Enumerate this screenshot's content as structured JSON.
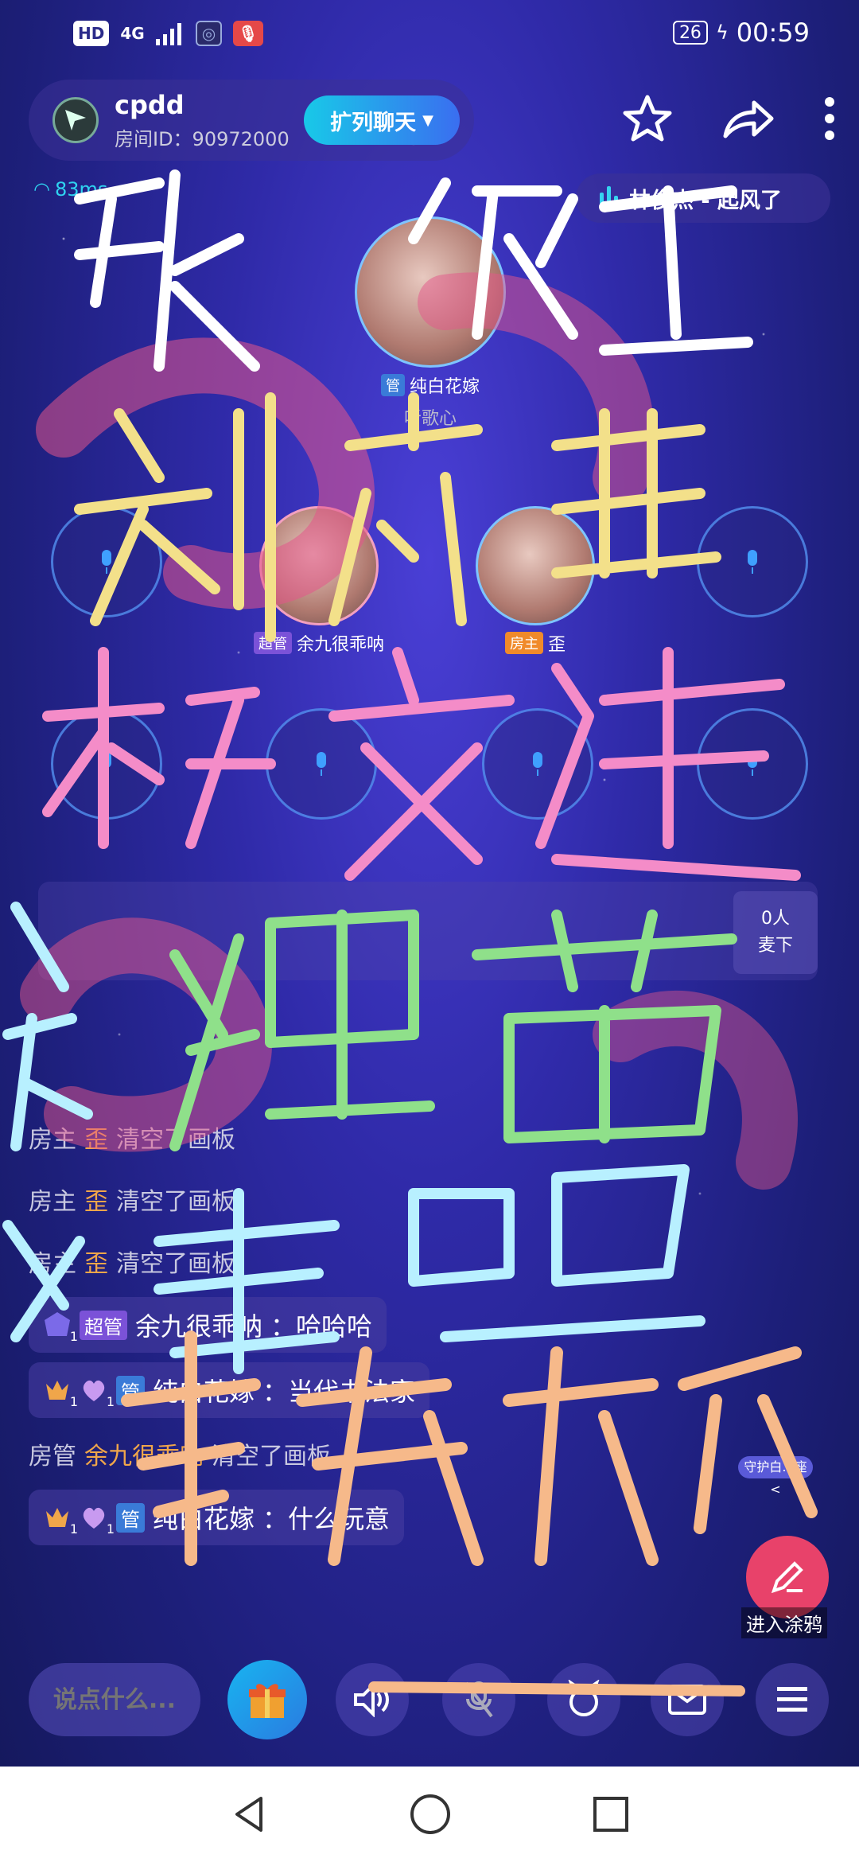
{
  "status_bar": {
    "hd": "HD",
    "network": "4G",
    "battery": "26",
    "time": "00:59"
  },
  "room": {
    "name": "cpdd",
    "id_label": "房间ID：90972000",
    "expand_button": "扩列聊天",
    "latency": "83ms",
    "now_playing": "林俊杰 - 起风了"
  },
  "host_seat": {
    "tag": "管",
    "name": "纯白花嫁",
    "status": "听歌心"
  },
  "seats_row1": [
    {
      "filled": false
    },
    {
      "filled": true,
      "tag": "超管",
      "name": "余九很乖呐"
    },
    {
      "filled": true,
      "tag": "房主",
      "name": "歪"
    },
    {
      "filled": false
    }
  ],
  "off_mic": {
    "count": "0人",
    "label": "麦下"
  },
  "chat": {
    "system_lines": [
      {
        "role": "房主",
        "who": "歪",
        "action": "清空了画板"
      },
      {
        "role": "房主",
        "who": "歪",
        "action": "清空了画板"
      },
      {
        "role": "房主",
        "who": "歪",
        "action": "清空了画板"
      }
    ],
    "msg1": {
      "tag": "超管",
      "name": "余九很乖呐",
      "text": "：哈哈哈",
      "level": "1"
    },
    "msg2": {
      "tag": "管",
      "name": "纯白花嫁",
      "text": "：当代书法家",
      "level": "1"
    },
    "system_line4": {
      "role": "房管",
      "who": "余九很乖呐",
      "action": "清空了画板"
    },
    "msg3": {
      "tag": "管",
      "name": "纯白花嫁",
      "text": "：什么玩意",
      "level": "1"
    }
  },
  "guard_tag": "守护白...座 <",
  "graffiti_button": "进入涂鸦",
  "input_placeholder": "说点什么...",
  "graffiti_text": [
    "张欣",
    "刘亦菲",
    "杨文健",
    "狸猫",
    "求教程",
    "谢楚"
  ],
  "colors": {
    "accent": "#18c9e8",
    "graffiti_white": "#ffffff",
    "graffiti_yellow": "#f3e08a",
    "graffiti_pink": "#f48cc8",
    "graffiti_green": "#8fe08a",
    "graffiti_orange": "#f6b98a",
    "graffiti_cyan": "#b8f0ff"
  }
}
